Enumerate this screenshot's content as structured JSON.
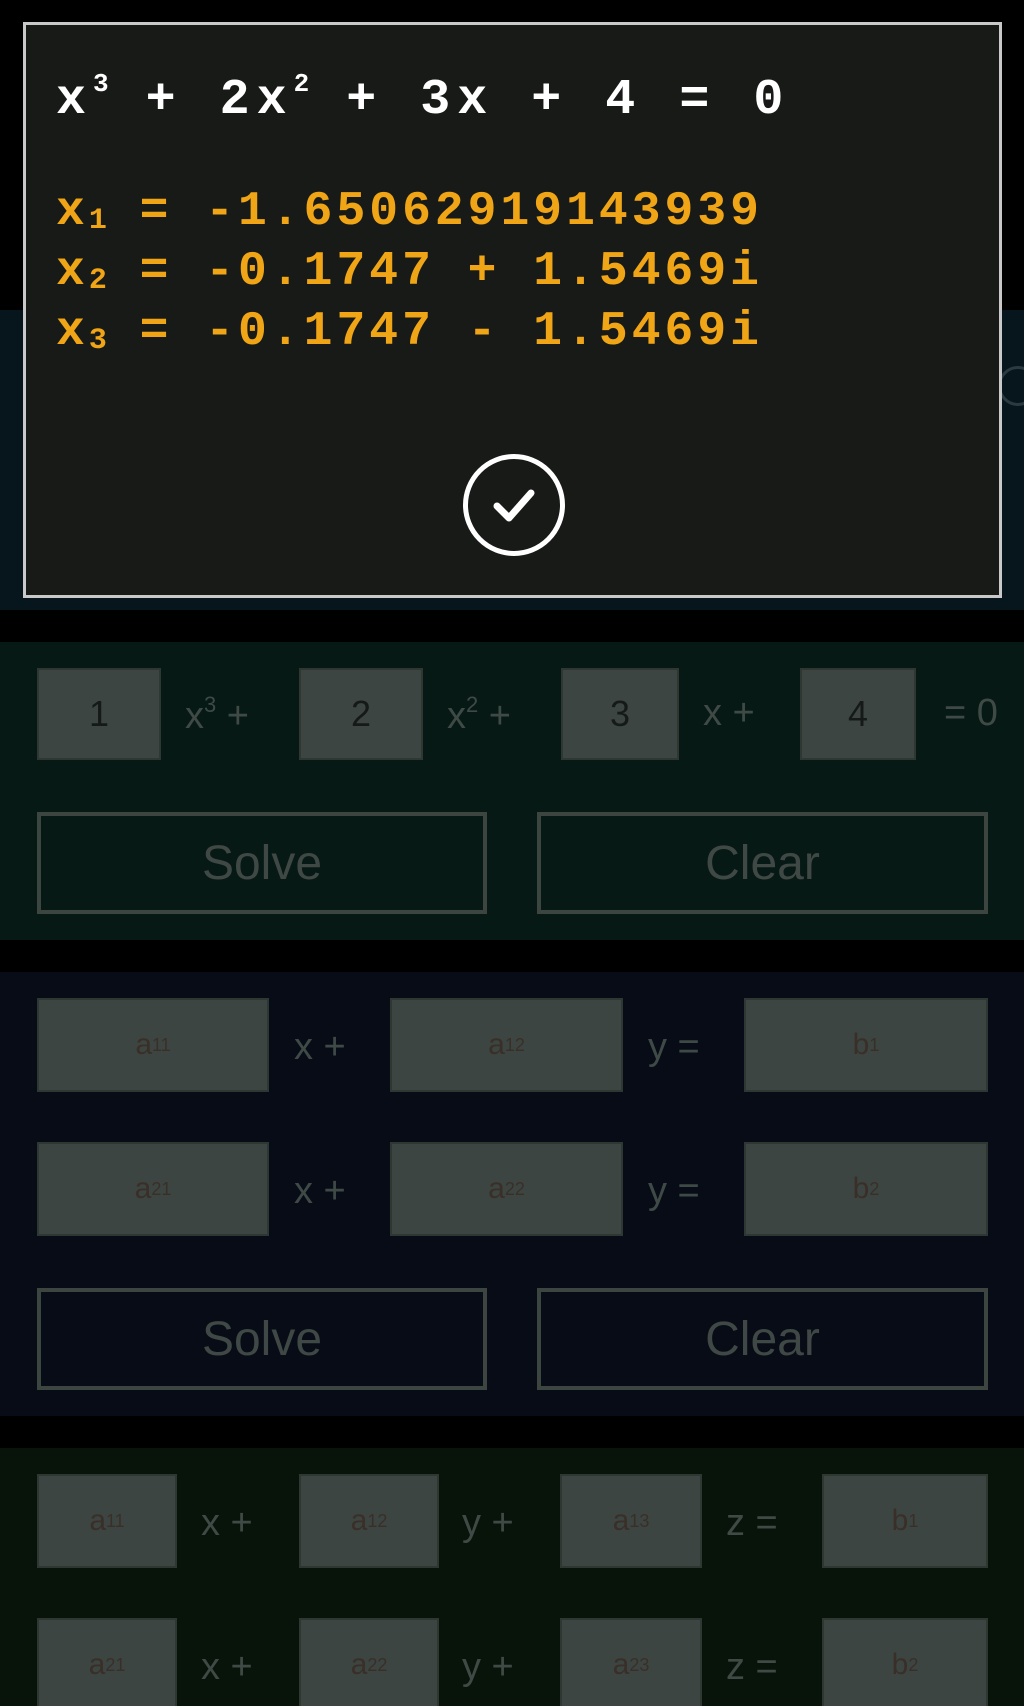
{
  "dialog": {
    "equation": {
      "t1": "x",
      "t1_exp": "3",
      "t2": " + 2x",
      "t2_exp": "2",
      "t3": " + 3x + 4 = 0"
    },
    "roots": [
      {
        "name": "x",
        "index": "1",
        "value": " = -1.65062919143939"
      },
      {
        "name": "x",
        "index": "2",
        "value": " = -0.1747 + 1.5469i"
      },
      {
        "name": "x",
        "index": "3",
        "value": " = -0.1747 - 1.5469i"
      }
    ],
    "ok_icon": "checkmark-circle-icon"
  },
  "cubic": {
    "a": "1",
    "b": "2",
    "c": "3",
    "d": "4",
    "x3": "x",
    "x3_exp": "3",
    "plus": " +",
    "x2": "x",
    "x2_exp": "2",
    "x1": "x +",
    "eq0": "= 0",
    "solve_label": "Solve",
    "clear_label": "Clear"
  },
  "system2": {
    "row1": {
      "a": "a",
      "a_sub": "11",
      "b": "a",
      "b_sub": "12",
      "c": "b",
      "c_sub": "1"
    },
    "row2": {
      "a": "a",
      "a_sub": "21",
      "b": "a",
      "b_sub": "22",
      "c": "b",
      "c_sub": "2"
    },
    "x_plus": "x +",
    "y_eq": "y =",
    "solve_label": "Solve",
    "clear_label": "Clear"
  },
  "system3": {
    "row1": {
      "a": "a",
      "a_sub": "11",
      "b": "a",
      "b_sub": "12",
      "c": "a",
      "c_sub": "13",
      "d": "b",
      "d_sub": "1"
    },
    "row2": {
      "a": "a",
      "a_sub": "21",
      "b": "a",
      "b_sub": "22",
      "c": "a",
      "c_sub": "23",
      "d": "b",
      "d_sub": "2"
    },
    "x_plus": "x +",
    "y_plus": "y +",
    "z_eq": "z ="
  },
  "colors": {
    "root_text": "#f0a517",
    "dialog_bg": "#181a17",
    "dialog_border": "#c9c9c9"
  }
}
